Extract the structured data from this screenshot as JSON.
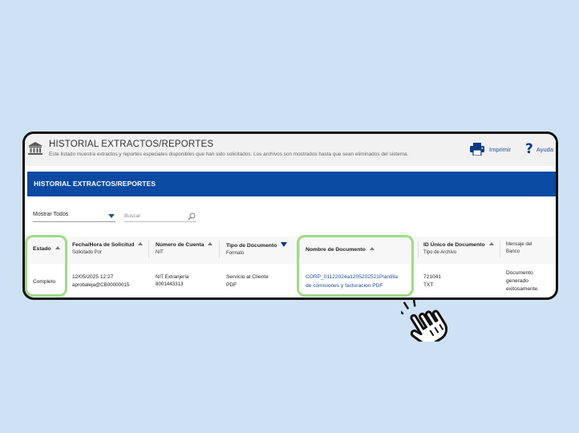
{
  "header": {
    "title": "HISTORIAL EXTRACTOS/REPORTES",
    "subtitle": "Este listado muestra extractos y reportes especiales disponibles que han sido solicitados. Los archivos son mostrados hasta que sean eliminados del sistema.",
    "print_label": "Imprimir",
    "help_label": "Ayuda"
  },
  "banner": {
    "title": "HISTORIAL EXTRACTOS/REPORTES"
  },
  "filters": {
    "select_value": "Mostrar Todos",
    "search_placeholder": "Buscar"
  },
  "table": {
    "columns": [
      {
        "label": "Estado",
        "sub": ""
      },
      {
        "label": "Fecha/Hora de Solicitud",
        "sub": "Solicitado Por"
      },
      {
        "label": "Número de Cuenta",
        "sub": "NIT"
      },
      {
        "label": "Tipo de Documento",
        "sub": "Formato"
      },
      {
        "label": "Nombre de Documento",
        "sub": ""
      },
      {
        "label": "ID Único de Documento",
        "sub": "Tipo de Archivo"
      },
      {
        "label": "Mensaje del",
        "sub": "Banco"
      }
    ],
    "rows": [
      {
        "estado": "Completo",
        "fecha": "12/05/2025 12:27",
        "solicitado_por": "aprobaleja@CB00000015",
        "cuenta": "NIT Extranjería",
        "nit": "8001443313",
        "tipo": "Servicio al Cliente",
        "formato": "PDF",
        "nombre_line1": "CORP_01122024a1205202521Plantilla",
        "nombre_line2": "de comisiones y facturacion.PDF",
        "id_unico": "721041",
        "tipo_archivo": "TXT",
        "mensaje_line1": "Documento",
        "mensaje_line2": "generado",
        "mensaje_line3": "exitosamente."
      }
    ]
  },
  "colors": {
    "brand_blue": "#0b4aa2",
    "link_blue": "#1f4e9e",
    "highlight_green": "#9edc87",
    "background": "#cfe2f5"
  },
  "icons": [
    "bank-icon",
    "print-icon",
    "help-icon",
    "search-icon",
    "pointing-hand-icon"
  ]
}
